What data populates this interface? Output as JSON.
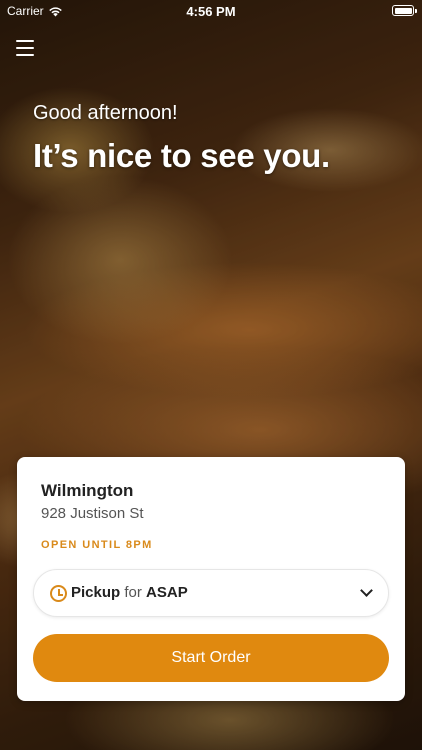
{
  "status_bar": {
    "carrier": "Carrier",
    "time": "4:56 PM"
  },
  "hero": {
    "greeting": "Good afternoon!",
    "headline": "It’s nice to see you."
  },
  "location_card": {
    "name": "Wilmington",
    "address": "928 Justison St",
    "hours": "OPEN UNTIL 8PM",
    "order_type": "Pickup",
    "for_label": "for",
    "order_time": "ASAP",
    "start_button": "Start Order"
  },
  "colors": {
    "accent": "#e0890f",
    "hours_text": "#d98a1b"
  }
}
